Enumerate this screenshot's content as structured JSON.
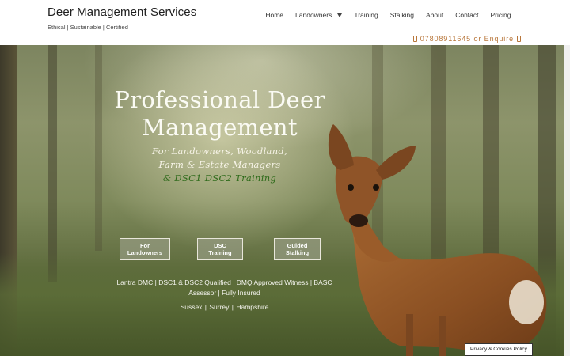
{
  "header": {
    "title": "Deer Management Services",
    "tagline": "Ethical | Sustainable | Certified",
    "nav": [
      "Home",
      "Landowners",
      "Training",
      "Stalking",
      "About",
      "Contact",
      "Pricing"
    ],
    "enquire": "07808911645 or Enquire"
  },
  "hero": {
    "title_line1": "Professional Deer",
    "title_line2": "Management",
    "sub_line1": "For Landowners, Woodland,",
    "sub_line2": "Farm & Estate Managers",
    "sub_line3": "& DSC1 DSC2 Training",
    "buttons": [
      {
        "line1": "For",
        "line2": "Landowners"
      },
      {
        "line1": "DSC",
        "line2": "Training"
      },
      {
        "line1": "Guided",
        "line2": "Stalking"
      }
    ],
    "credentials": "Lantra DMC | DSC1 & DSC2 Qualified | DMQ Approved Witness | BASC Assessor | Fully Insured",
    "areas": "Sussex  |  Surrey  |  Hampshire"
  },
  "privacy": "Privacy & Cookies Policy",
  "colors": {
    "accent": "#b8763a",
    "green": "#2f6b1b"
  }
}
